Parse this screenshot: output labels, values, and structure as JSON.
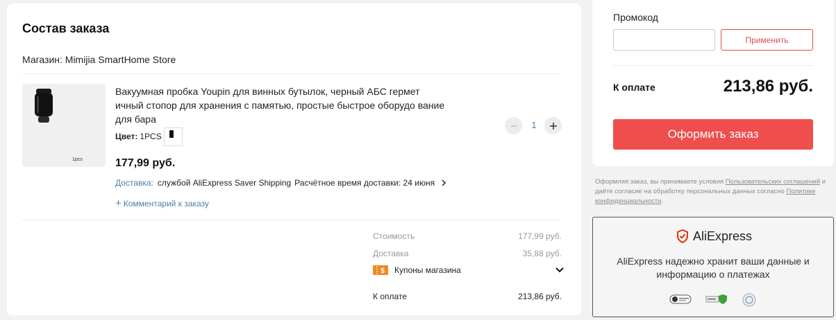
{
  "order": {
    "title": "Состав заказа",
    "store": "Магазин: Mimijia SmartHome Store",
    "product": {
      "title": "Вакуумная пробка Youpin для винных бутылок, черный АБС гермет ичный стопор для хранения с памятью, простые быстрое оборудо вание для бара",
      "image_caption": "1pcs",
      "color_label": "Цвет:",
      "color_value": "1PCS",
      "price": "177,99 руб.",
      "delivery_label": "Доставка:",
      "delivery_method": "службой AliExpress Saver Shipping",
      "delivery_eta": "Расчётное время доставки: 24 июня",
      "comment_link": "Комментарий к заказу",
      "quantity": "1"
    },
    "summary": {
      "cost_label": "Стоимость",
      "cost_value": "177,99 руб.",
      "shipping_label": "Доставка",
      "shipping_value": "35,88 руб.",
      "coupons_label": "Купоны магазина",
      "total_label": "К оплате",
      "total_value": "213,86 руб."
    }
  },
  "checkout": {
    "promo_label": "Промокод",
    "promo_value": "",
    "apply_label": "Применить",
    "pay_label": "К оплате",
    "pay_amount": "213,86 руб.",
    "checkout_label": "Оформить заказ"
  },
  "legal": {
    "text_1": "Оформляя заказ, вы принимаете условия ",
    "link_1": "Пользовательских соглашений",
    "text_2": " и даёте согласие на обработку персональных данных согласно ",
    "link_2": "Политике конфиденциальности",
    "text_3": "."
  },
  "trust": {
    "brand": "AliExpress",
    "message": "AliExpress надежно хранит ваши данные и информацию о платежах"
  },
  "colors": {
    "accent_red": "#f04d4d",
    "link_blue": "#4a7fa7",
    "coupon_orange": "#f08a24"
  },
  "icons": [
    "minus-icon",
    "plus-icon",
    "chevron-right-icon",
    "chevron-down-icon",
    "coupon-icon",
    "shield-check-icon",
    "security-badge-icon"
  ]
}
